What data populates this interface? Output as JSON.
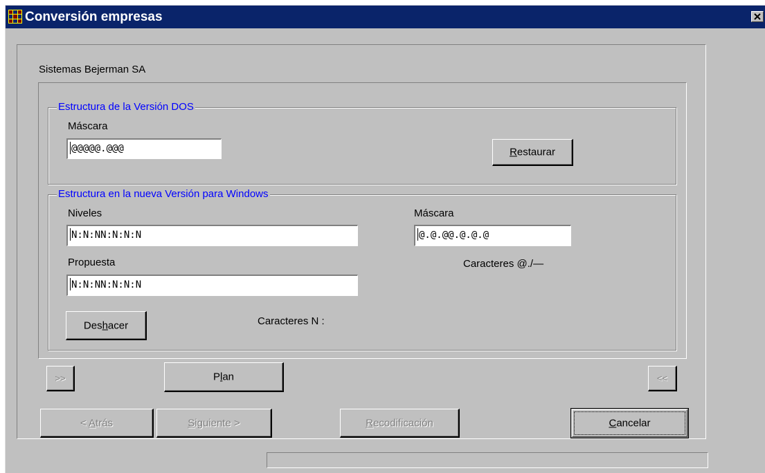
{
  "window": {
    "title": "Conversión empresas",
    "icon": "app-grid-icon",
    "close_icon": "close-icon"
  },
  "company": "Sistemas Bejerman SA",
  "dos_group": {
    "legend": "Estructura de la Versión DOS",
    "mask_label": "Máscara",
    "mask_value": "@@@@@.@@@",
    "restore_button": {
      "pre": "",
      "key": "R",
      "post": "estaurar"
    }
  },
  "windows_group": {
    "legend": "Estructura en la nueva Versión para Windows",
    "levels_label": "Niveles",
    "levels_value": "N:N:NN:N:N:N",
    "proposal_label": "Propuesta",
    "proposal_value": "N:N:NN:N:N:N",
    "mask_label": "Máscara",
    "mask_value": "@.@.@@.@.@.@",
    "mask_chars_label": "Caracteres @./—",
    "undo_button": {
      "pre": "Des",
      "key": "h",
      "post": "acer"
    },
    "level_chars_label": "Caracteres  N  :"
  },
  "nav": {
    "forward_label": ">>",
    "plan_button": {
      "pre": "P",
      "key": "l",
      "post": "an"
    },
    "back_label": "<<"
  },
  "footer": {
    "back_button": {
      "pre": "< ",
      "key": "A",
      "post": "trás"
    },
    "next_button": {
      "pre": "",
      "key": "S",
      "post": "iguiente >"
    },
    "recode_button": {
      "pre": "",
      "key": "R",
      "post": "ecodificación"
    },
    "cancel_button": {
      "pre": "",
      "key": "C",
      "post": "ancelar"
    }
  },
  "colors": {
    "titlebar": "#0a246a",
    "face": "#c0c0c0",
    "legend_text": "#0000ff"
  }
}
